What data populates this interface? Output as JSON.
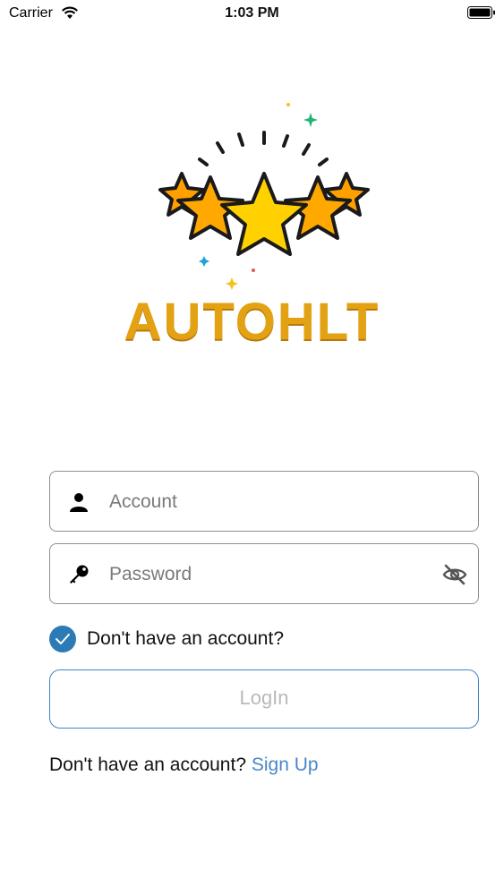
{
  "status_bar": {
    "carrier": "Carrier",
    "time": "1:03 PM"
  },
  "logo": {
    "brand_text": "AUTOHLT",
    "brand_color": "#E3A213"
  },
  "account_field": {
    "placeholder": "Account",
    "value": "",
    "icon": "user-icon"
  },
  "password_field": {
    "placeholder": "Password",
    "value": "",
    "icon": "key-icon",
    "toggle_icon": "eye-slash-icon"
  },
  "remember": {
    "checked": true,
    "label": "Don't have an account?"
  },
  "login_button": {
    "label": "LogIn"
  },
  "signup": {
    "prompt": "Don't have an account? ",
    "link": "Sign Up"
  },
  "colors": {
    "accent": "#2C7AB6",
    "link": "#4A86C8",
    "star_gold": "#FFD100",
    "star_orange": "#FFA000"
  }
}
